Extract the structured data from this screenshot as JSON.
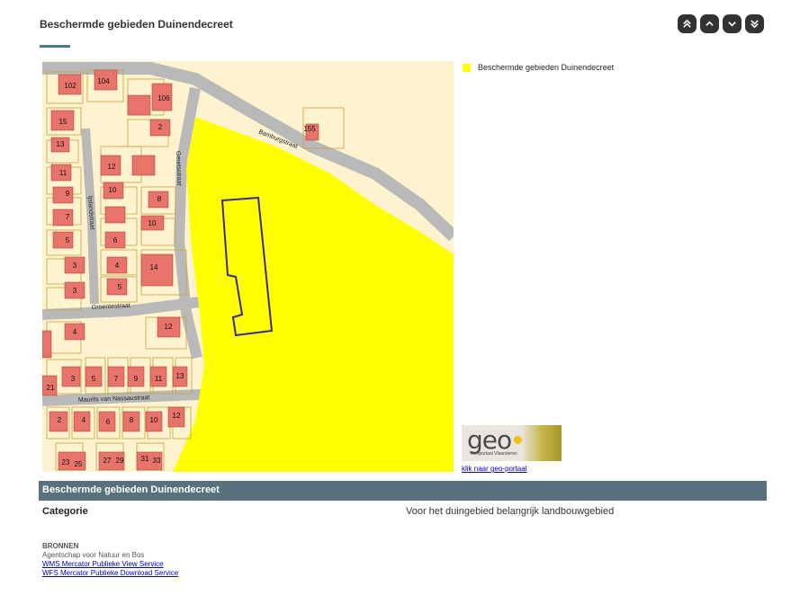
{
  "page": {
    "title": "Beschermde gebieden Duinendecreet"
  },
  "nav": {
    "buttons": [
      "first-icon",
      "previous-icon",
      "next-icon",
      "last-icon"
    ]
  },
  "map": {
    "house_numbers": [
      "102",
      "104",
      "106",
      "15",
      "2",
      "155",
      "13",
      "12",
      "11",
      "9",
      "10",
      "8",
      "7",
      "10",
      "5",
      "6",
      "3",
      "4",
      "14",
      "3",
      "5",
      "12",
      "4",
      "3",
      "5",
      "7",
      "9",
      "11",
      "13",
      "21",
      "2",
      "4",
      "6",
      "8",
      "10",
      "12",
      "23",
      "25",
      "27",
      "29",
      "31",
      "33"
    ],
    "streets": {
      "bamburgstraat": "Bamburgstraat",
      "geretsstraat": "Geretsstraat",
      "ijslandstraat": "Ijslandstraat",
      "groentestraat": "Groentestraat",
      "maurits": "Maurits van Nassaustraat"
    },
    "colors": {
      "background": "#fdf3cf",
      "protected_area": "#ffff00",
      "building": "#e8736a",
      "road": "#b9b9b9",
      "parcel_outline": "#c9a23a",
      "selection": "#3a2b9a"
    }
  },
  "legend": {
    "label": "Beschermde gebieden Duinendecreet",
    "color": "#ffff00"
  },
  "geo": {
    "logo_text": "geo",
    "logo_subtext": "Geoportaal Vlaanderen",
    "link_text": "klik naar geo-portaal"
  },
  "info": {
    "header": "Beschermde gebieden Duinendecreet",
    "label": "Categorie",
    "value": "Voor het duingebied belangrijk landbouwgebied"
  },
  "sources": {
    "title": "BRONNEN",
    "agency": "Agentschap voor Natuur en Bos",
    "links": [
      "WMS Mercator Publieke View Service",
      "WFS Mercator Publieke Download Service"
    ]
  }
}
